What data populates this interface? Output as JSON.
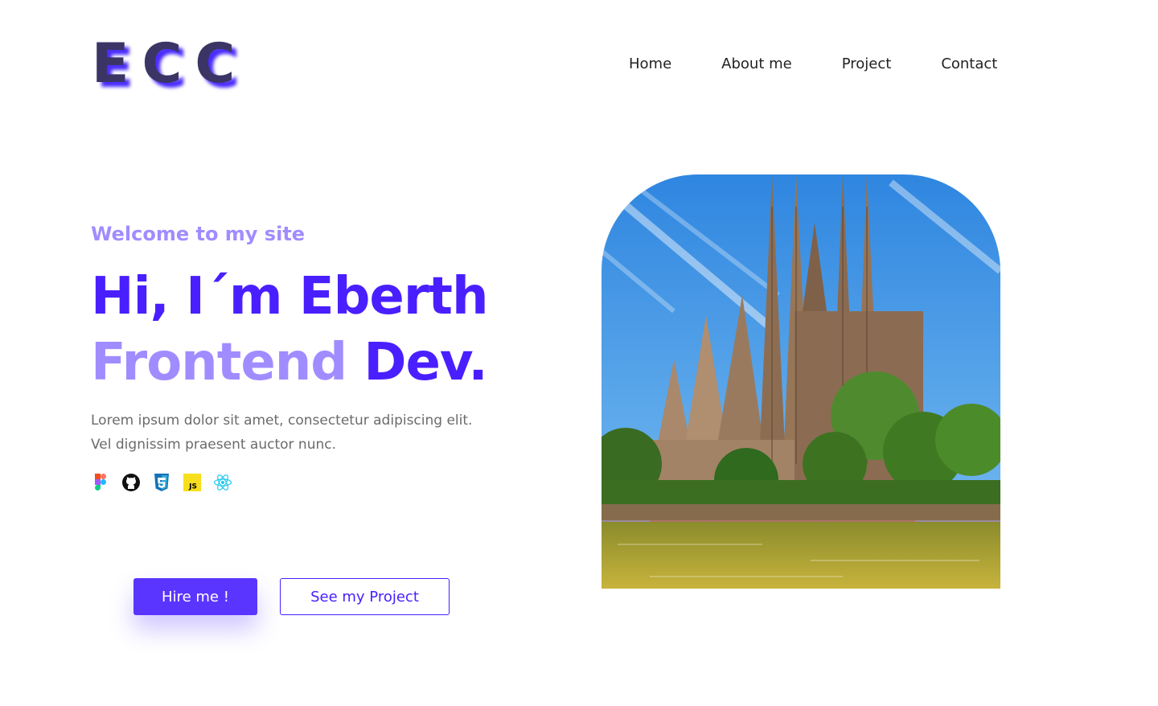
{
  "brand": {
    "logo_text": "ECC"
  },
  "nav": {
    "items": [
      {
        "label": "Home"
      },
      {
        "label": "About me"
      },
      {
        "label": "Project"
      },
      {
        "label": "Contact"
      }
    ]
  },
  "hero": {
    "welcome": "Welcome to my site",
    "headline_line1": "Hi, I´m Eberth",
    "headline_role": "Frontend",
    "headline_suffix": " Dev.",
    "description_line1": "Lorem ipsum dolor sit amet, consectetur adipiscing elit.",
    "description_line2": "Vel dignissim praesent auctor nunc.",
    "tech_icons": [
      "figma-icon",
      "github-icon",
      "css3-icon",
      "javascript-icon",
      "react-icon"
    ],
    "js_badge": "JS",
    "hire_button": "Hire me !",
    "project_button": "See my Project",
    "image_alt": "Sagrada Familia"
  },
  "colors": {
    "primary": "#4a1fff",
    "button": "#5a35ff",
    "accent_light": "#a18cff",
    "logo_text": "#3b3566",
    "logo_shadow": "#4a2cff",
    "body_text": "#6b6b6b"
  }
}
